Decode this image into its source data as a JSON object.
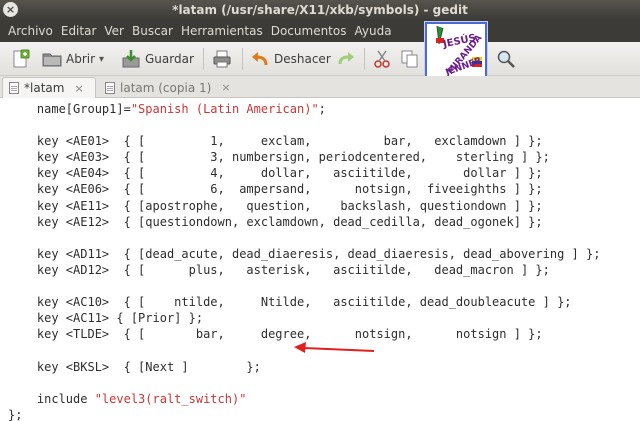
{
  "window": {
    "title": "*latam (/usr/share/X11/xkb/symbols) - gedit",
    "close_glyph": "×"
  },
  "menu": [
    "Archivo",
    "Editar",
    "Ver",
    "Buscar",
    "Herramientas",
    "Documentos",
    "Ayuda"
  ],
  "toolbar": {
    "open_label": "Abrir",
    "open_arrow": "▾",
    "save_label": "Guardar",
    "undo_label": "Deshacer"
  },
  "logo": {
    "line1": "JESÚS",
    "line2": "MIRANDA",
    "line3": "JENNER"
  },
  "tabs": [
    {
      "label": "*latam",
      "close": "×",
      "active": true
    },
    {
      "label": "latam (copia 1)",
      "close": "×",
      "active": false
    }
  ],
  "code": {
    "lines": [
      {
        "text": "    name[Group1]=",
        "str": "\"Spanish (Latin American)\"",
        "tail": ";"
      },
      {
        "text": ""
      },
      {
        "text": "    key <AE01>  { [         1,     exclam,          bar,   exclamdown ] };"
      },
      {
        "text": "    key <AE03>  { [         3, numbersign, periodcentered,    sterling ] };"
      },
      {
        "text": "    key <AE04>  { [         4,     dollar,   asciitilde,       dollar ] };"
      },
      {
        "text": "    key <AE06>  { [         6,  ampersand,      notsign,  fiveeighths ] };"
      },
      {
        "text": "    key <AE11>  { [apostrophe,   question,    backslash, questiondown ] };"
      },
      {
        "text": "    key <AE12>  { [questiondown, exclamdown, dead_cedilla, dead_ogonek] };"
      },
      {
        "text": ""
      },
      {
        "text": "    key <AD11>  { [dead_acute, dead_diaeresis, dead_diaeresis, dead_abovering ] };"
      },
      {
        "text": "    key <AD12>  { [      plus,   asterisk,   asciitilde,   dead_macron ] };"
      },
      {
        "text": ""
      },
      {
        "text": "    key <AC10>  { [    ntilde,     Ntilde,   asciitilde, dead_doubleacute ] };"
      },
      {
        "text": "    key <AC11> { [Prior] };"
      },
      {
        "text": "    key <TLDE>  { [       bar,     degree,      notsign,      notsign ] };"
      },
      {
        "text": ""
      },
      {
        "text": "    key <BKSL>  { [Next ]        };"
      },
      {
        "text": ""
      },
      {
        "text": "    include ",
        "str": "\"level3(ralt_switch)\"",
        "tail": ""
      },
      {
        "text": "};"
      }
    ]
  },
  "colors": {
    "annotation_arrow": "#e02020",
    "string": "#c83737",
    "menubar": "#3c3b37"
  }
}
